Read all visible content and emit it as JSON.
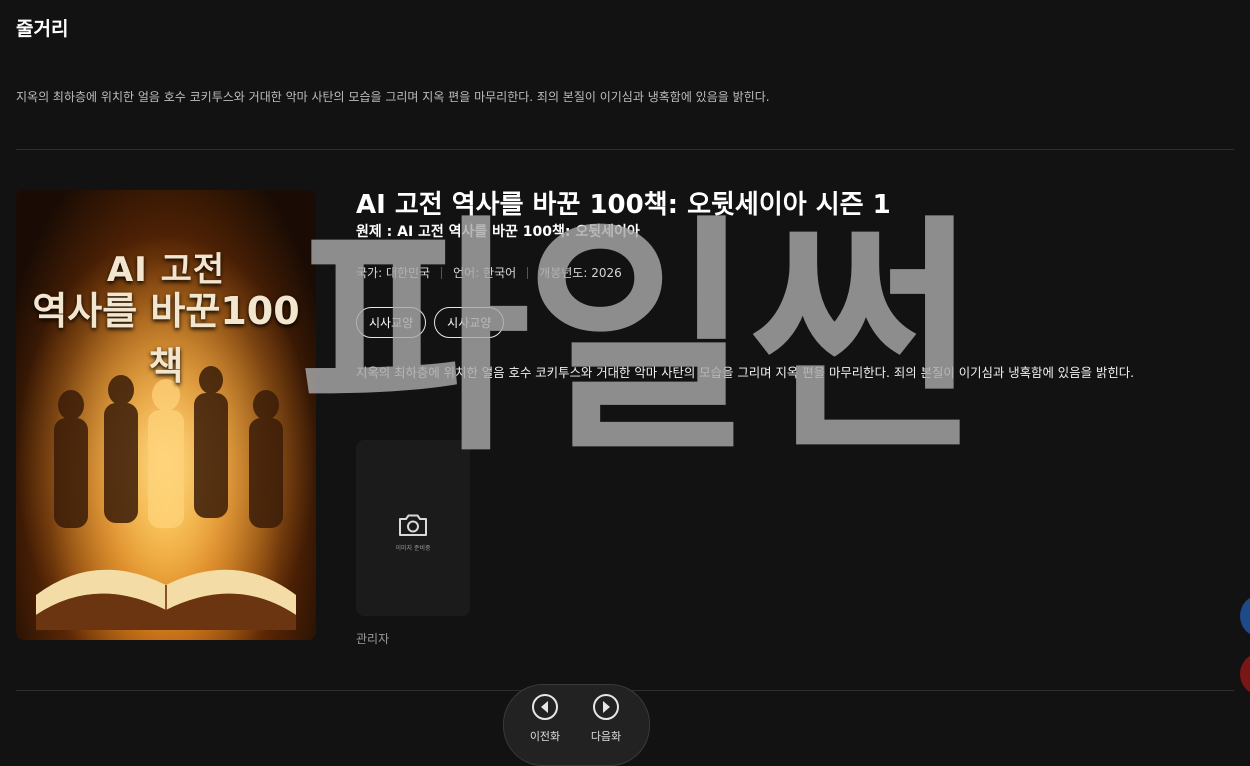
{
  "section": {
    "title": "줄거리"
  },
  "synopsis": "지옥의 최하층에 위치한 얼음 호수 코키투스와 거대한 악마 사탄의 모습을 그리며 지옥 편을 마무리한다. 죄의 본질이 이기심과 냉혹함에 있음을 밝힌다.",
  "poster": {
    "line1": "AI 고전",
    "line2": "역사를 바꾼100책"
  },
  "detail": {
    "title": "AI 고전 역사를 바꾼 100책: 오뒷세이아 시즌 1",
    "original_title": "원제 : AI 고전 역사를 바꾼 100책: 오뒷세이아",
    "country": "국가: 대한민국",
    "language": "언어: 한국어",
    "year": "개봉년도: 2026",
    "tags": [
      "시사교양",
      "시사교양"
    ],
    "description": "지옥의 최하층에 위치한 얼음 호수 코키투스와 거대한 악마 사탄의 모습을 그리며 지옥 편을 마무리한다. 죄의 본질이 이기심과 냉혹함에 있음을 밝힌다.",
    "image_placeholder": "이미지 준비중",
    "author": "관리자"
  },
  "watermark": "파일썬",
  "nav": {
    "prev": "이전화",
    "next": "다음화"
  },
  "colors": {
    "background": "#121212",
    "pill": "#222222"
  }
}
